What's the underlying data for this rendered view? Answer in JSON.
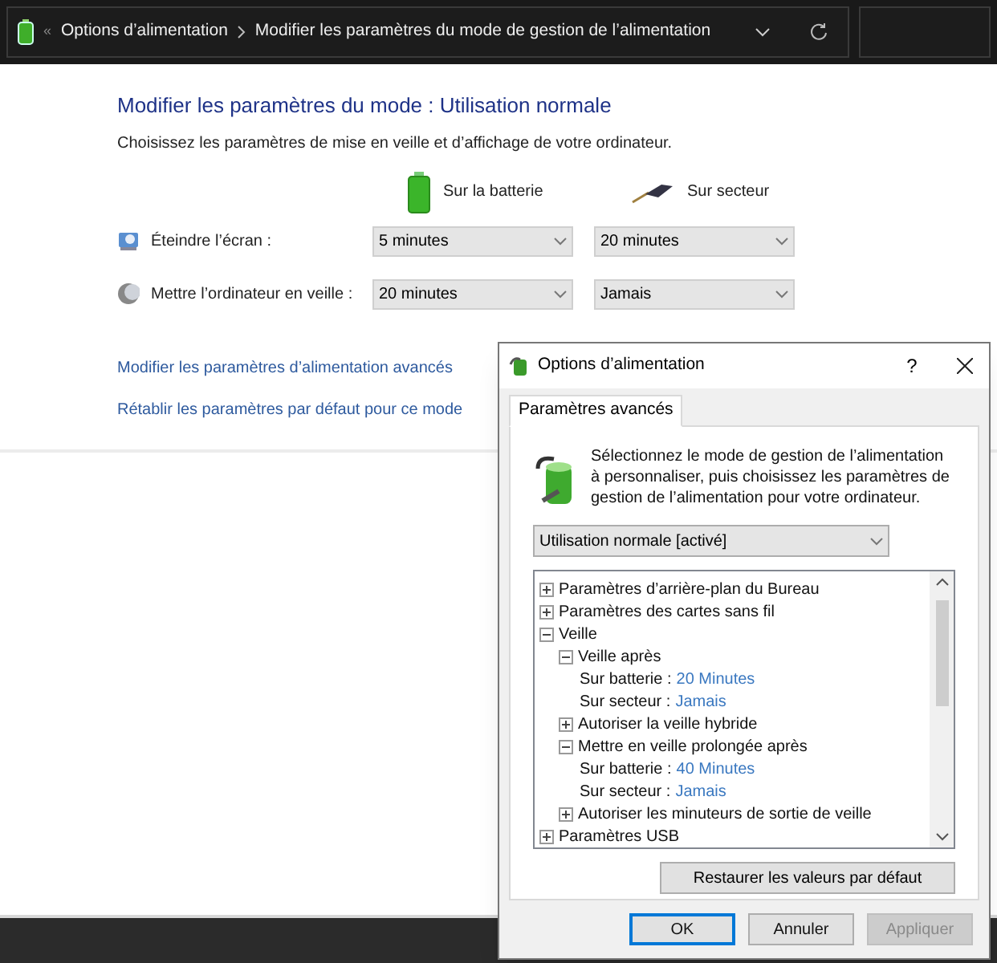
{
  "address_bar": {
    "overflow": "«",
    "breadcrumbs": [
      "Options d’alimentation",
      "Modifier les paramètres du mode de gestion de l’alimentation"
    ]
  },
  "page": {
    "title": "Modifier les paramètres du mode : Utilisation normale",
    "subtitle": "Choisissez les paramètres de mise en veille et d’affichage de votre ordinateur.",
    "columns": [
      {
        "kind": "battery",
        "label": "Sur la batterie"
      },
      {
        "kind": "plug",
        "label": "Sur secteur"
      }
    ],
    "settings": [
      {
        "kind": "display",
        "label": "Éteindre l’écran :",
        "values": [
          "5 minutes",
          "20 minutes"
        ]
      },
      {
        "kind": "sleep",
        "label": "Mettre l’ordinateur en veille :",
        "values": [
          "20 minutes",
          "Jamais"
        ]
      }
    ],
    "links": [
      "Modifier les paramètres d’alimentation avancés",
      "Rétablir les paramètres par défaut pour ce mode"
    ]
  },
  "dialog": {
    "title": "Options d’alimentation",
    "help": "?",
    "tabs": [
      {
        "label": "Paramètres avancés",
        "selected": true
      }
    ],
    "description": "Sélectionnez le mode de gestion de l’alimentation à personnaliser, puis choisissez les paramètres de gestion de l’alimentation pour votre ordinateur.",
    "plan": "Utilisation normale [activé]",
    "tree": [
      {
        "label": "Paramètres d’arrière-plan du Bureau",
        "expanded": false
      },
      {
        "label": "Paramètres des cartes sans fil",
        "expanded": false
      },
      {
        "label": "Veille",
        "expanded": true,
        "children": [
          {
            "label": "Veille après",
            "expanded": true,
            "children": [
              {
                "label": "Sur batterie :",
                "value": "20 Minutes"
              },
              {
                "label": "Sur secteur :",
                "value": "Jamais"
              }
            ]
          },
          {
            "label": "Autoriser la veille hybride",
            "expanded": false
          },
          {
            "label": "Mettre en veille prolongée après",
            "expanded": true,
            "children": [
              {
                "label": "Sur batterie :",
                "value": "40 Minutes"
              },
              {
                "label": "Sur secteur :",
                "value": "Jamais"
              }
            ]
          },
          {
            "label": "Autoriser les minuteurs de sortie de veille",
            "expanded": false
          }
        ]
      },
      {
        "label": "Paramètres USB",
        "expanded": false
      }
    ],
    "restore_button": "Restaurer les valeurs par défaut",
    "buttons": [
      {
        "label": "OK",
        "disabled": false,
        "default": true
      },
      {
        "label": "Annuler",
        "disabled": false,
        "default": false
      },
      {
        "label": "Appliquer",
        "disabled": true,
        "default": false
      }
    ]
  }
}
